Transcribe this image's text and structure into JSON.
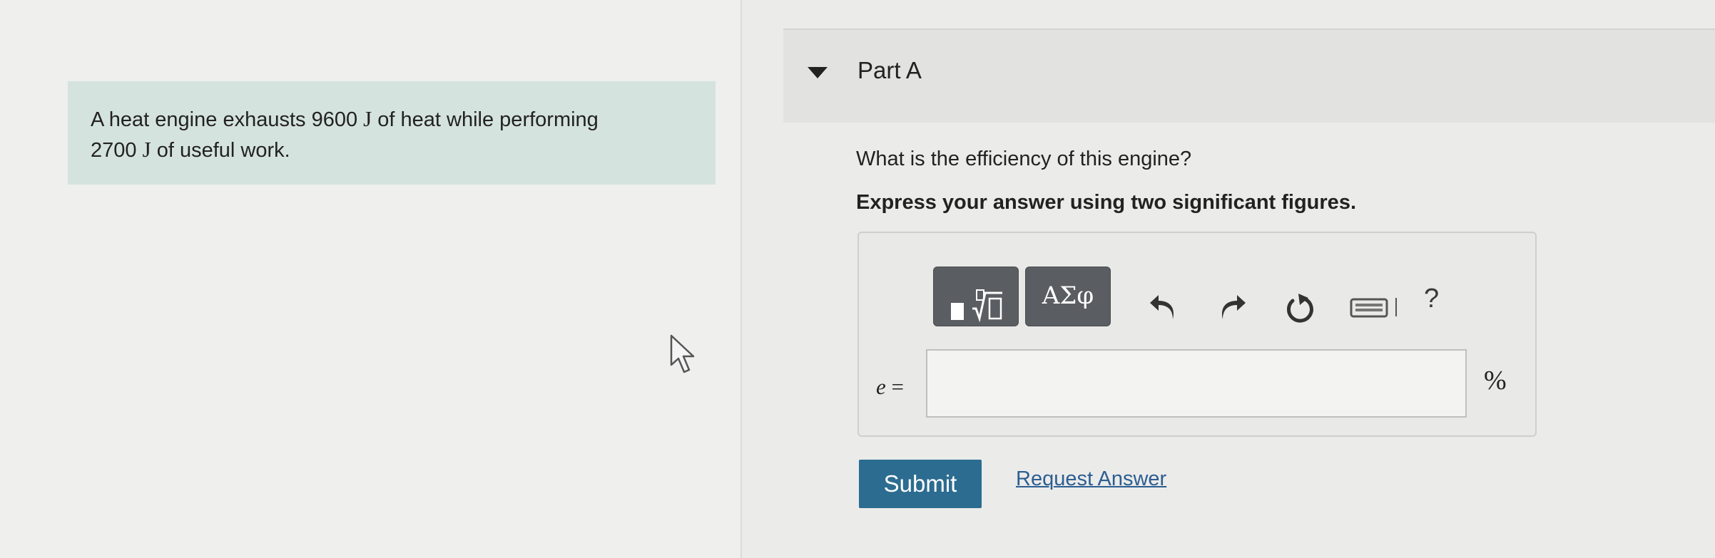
{
  "problem": {
    "text_1": "A heat engine exhausts 9600",
    "unit_1": "J",
    "text_2": "of heat while performing",
    "text_3": "2700",
    "unit_2": "J",
    "text_4": "of useful work."
  },
  "part": {
    "title": "Part A",
    "question": "What is the efficiency of this engine?",
    "instruction": "Express your answer using two significant figures."
  },
  "toolbar": {
    "greek_label": "ΑΣφ",
    "help_label": "?"
  },
  "answer": {
    "variable": "e",
    "equals": "=",
    "value": "",
    "unit": "%"
  },
  "actions": {
    "submit_label": "Submit",
    "request_label": "Request Answer"
  },
  "colors": {
    "problem_bg": "#d5e3df",
    "submit_bg": "#2c6c90",
    "link": "#2d5e91",
    "toolbar_button": "#5a5d61"
  }
}
